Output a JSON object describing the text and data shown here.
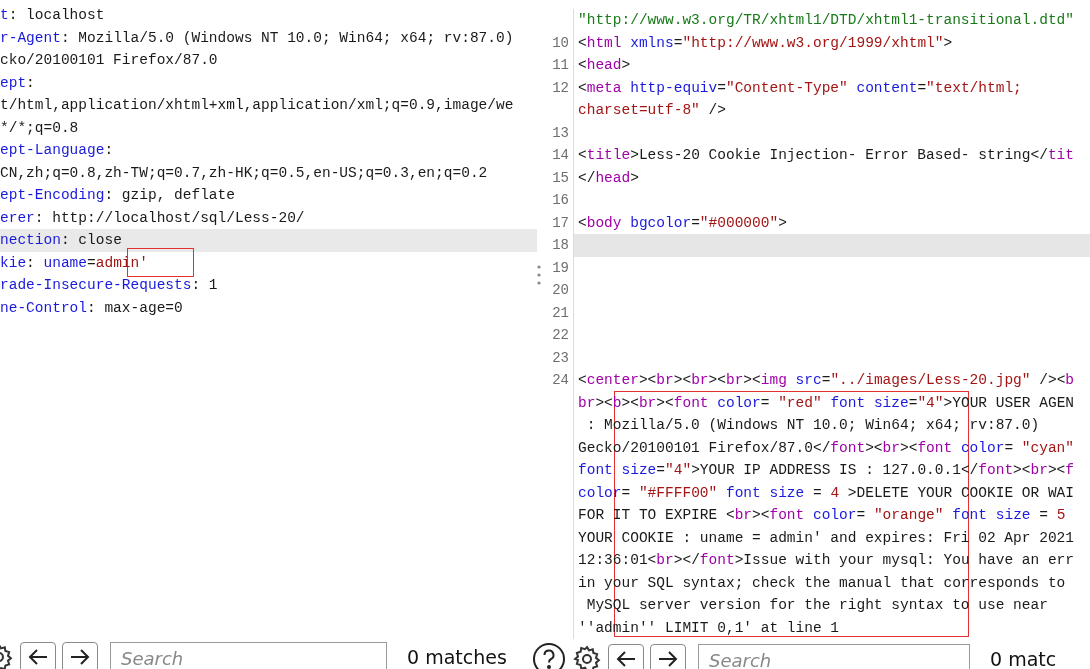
{
  "request_pane": {
    "lines": [
      {
        "current": false,
        "tokens": [
          {
            "kind": "attr",
            "text": "t"
          },
          {
            "kind": "text",
            "text": ": localhost"
          }
        ]
      },
      {
        "current": false,
        "tokens": [
          {
            "kind": "attr",
            "text": "r-Agent"
          },
          {
            "kind": "text",
            "text": ": Mozilla/5.0 (Windows NT 10.0; Win64; x64; rv:87.0)"
          }
        ]
      },
      {
        "current": false,
        "tokens": [
          {
            "kind": "text",
            "text": "cko/20100101 Firefox/87.0"
          }
        ]
      },
      {
        "current": false,
        "tokens": [
          {
            "kind": "attr",
            "text": "ept"
          },
          {
            "kind": "text",
            "text": ":"
          }
        ]
      },
      {
        "current": false,
        "tokens": [
          {
            "kind": "text",
            "text": "t/html,application/xhtml+xml,application/xml;q=0.9,image/we"
          }
        ]
      },
      {
        "current": false,
        "tokens": [
          {
            "kind": "text",
            "text": "*/*;q=0.8"
          }
        ]
      },
      {
        "current": false,
        "tokens": [
          {
            "kind": "attr",
            "text": "ept-Language"
          },
          {
            "kind": "text",
            "text": ":"
          }
        ]
      },
      {
        "current": false,
        "tokens": [
          {
            "kind": "text",
            "text": "CN,zh;q=0.8,zh-TW;q=0.7,zh-HK;q=0.5,en-US;q=0.3,en;q=0.2"
          }
        ]
      },
      {
        "current": false,
        "tokens": [
          {
            "kind": "attr",
            "text": "ept-Encoding"
          },
          {
            "kind": "text",
            "text": ": gzip, deflate"
          }
        ]
      },
      {
        "current": false,
        "tokens": [
          {
            "kind": "attr",
            "text": "erer"
          },
          {
            "kind": "text",
            "text": ": http://localhost/sql/Less-20/"
          }
        ]
      },
      {
        "current": true,
        "tokens": [
          {
            "kind": "attr",
            "text": "nection"
          },
          {
            "kind": "text",
            "text": ": close"
          }
        ]
      },
      {
        "current": false,
        "tokens": [
          {
            "kind": "attr",
            "text": "kie"
          },
          {
            "kind": "text",
            "text": ": "
          },
          {
            "kind": "attr",
            "text": "uname"
          },
          {
            "kind": "text",
            "text": "="
          },
          {
            "kind": "string",
            "text": "admin'"
          }
        ]
      },
      {
        "current": false,
        "tokens": [
          {
            "kind": "attr",
            "text": "rade-Insecure-Requests"
          },
          {
            "kind": "text",
            "text": ": 1"
          }
        ]
      },
      {
        "current": false,
        "tokens": [
          {
            "kind": "attr",
            "text": "ne-Control"
          },
          {
            "kind": "text",
            "text": ": max-age=0"
          }
        ]
      }
    ]
  },
  "response_pane": {
    "lines": [
      {
        "current": false,
        "rows": [
          {
            "tokens": [
              {
                "kind": "doctype",
                "text": "\"http://www.w3.org/TR/xhtml1/DTD/xhtml1-transitional.dtd\""
              }
            ]
          }
        ]
      },
      {
        "number": "10",
        "current": false,
        "rows": [
          {
            "tokens": [
              {
                "kind": "text",
                "text": "<"
              },
              {
                "kind": "tag",
                "text": "html "
              },
              {
                "kind": "attr",
                "text": "xmlns"
              },
              {
                "kind": "text",
                "text": "="
              },
              {
                "kind": "string",
                "text": "\"http://www.w3.org/1999/xhtml\""
              },
              {
                "kind": "text",
                "text": ">"
              }
            ]
          }
        ]
      },
      {
        "number": "11",
        "current": false,
        "rows": [
          {
            "tokens": [
              {
                "kind": "text",
                "text": "<"
              },
              {
                "kind": "tag",
                "text": "head"
              },
              {
                "kind": "text",
                "text": ">"
              }
            ]
          }
        ]
      },
      {
        "number": "12",
        "current": false,
        "rows": [
          {
            "tokens": [
              {
                "kind": "text",
                "text": "<"
              },
              {
                "kind": "tag",
                "text": "meta "
              },
              {
                "kind": "attr",
                "text": "http-equiv"
              },
              {
                "kind": "text",
                "text": "="
              },
              {
                "kind": "string",
                "text": "\"Content-Type\" "
              },
              {
                "kind": "attr",
                "text": "content"
              },
              {
                "kind": "text",
                "text": "="
              },
              {
                "kind": "string",
                "text": "\"text/html;"
              }
            ]
          },
          {
            "tokens": [
              {
                "kind": "string",
                "text": "charset=utf-8\""
              },
              {
                "kind": "text",
                "text": " />"
              }
            ]
          }
        ]
      },
      {
        "number": "13",
        "current": false,
        "rows": [
          {}
        ]
      },
      {
        "number": "14",
        "current": false,
        "rows": [
          {
            "tokens": [
              {
                "kind": "text",
                "text": "<"
              },
              {
                "kind": "tag",
                "text": "title"
              },
              {
                "kind": "text",
                "text": ">Less-20 Cookie Injection- Error Based- string</"
              },
              {
                "kind": "tag",
                "text": "tit"
              }
            ]
          }
        ]
      },
      {
        "number": "15",
        "current": false,
        "rows": [
          {
            "tokens": [
              {
                "kind": "text",
                "text": "</"
              },
              {
                "kind": "tag",
                "text": "head"
              },
              {
                "kind": "text",
                "text": ">"
              }
            ]
          }
        ]
      },
      {
        "number": "16",
        "current": false,
        "rows": [
          {}
        ]
      },
      {
        "number": "17",
        "current": false,
        "rows": [
          {
            "tokens": [
              {
                "kind": "text",
                "text": "<"
              },
              {
                "kind": "tag",
                "text": "body "
              },
              {
                "kind": "attr",
                "text": "bgcolor"
              },
              {
                "kind": "text",
                "text": "="
              },
              {
                "kind": "string",
                "text": "\"#000000\""
              },
              {
                "kind": "text",
                "text": ">"
              }
            ]
          }
        ]
      },
      {
        "number": "18",
        "current": true,
        "rows": [
          {}
        ]
      },
      {
        "number": "19",
        "current": false,
        "rows": [
          {}
        ]
      },
      {
        "number": "20",
        "current": false,
        "rows": [
          {}
        ]
      },
      {
        "number": "21",
        "current": false,
        "rows": [
          {}
        ]
      },
      {
        "number": "22",
        "current": false,
        "rows": [
          {}
        ]
      },
      {
        "number": "23",
        "current": false,
        "rows": [
          {}
        ]
      },
      {
        "number": "24",
        "current": false,
        "rows": [
          {
            "tokens": [
              {
                "kind": "text",
                "text": "<"
              },
              {
                "kind": "tag",
                "text": "center"
              },
              {
                "kind": "text",
                "text": "><"
              },
              {
                "kind": "tag",
                "text": "br"
              },
              {
                "kind": "text",
                "text": "><"
              },
              {
                "kind": "tag",
                "text": "br"
              },
              {
                "kind": "text",
                "text": "><"
              },
              {
                "kind": "tag",
                "text": "br"
              },
              {
                "kind": "text",
                "text": "><"
              },
              {
                "kind": "tag",
                "text": "img "
              },
              {
                "kind": "attr",
                "text": "src"
              },
              {
                "kind": "text",
                "text": "="
              },
              {
                "kind": "string",
                "text": "\"../images/Less-20.jpg\""
              },
              {
                "kind": "text",
                "text": " /><"
              },
              {
                "kind": "tag",
                "text": "b"
              }
            ]
          },
          {
            "tokens": [
              {
                "kind": "tag",
                "text": "br"
              },
              {
                "kind": "text",
                "text": "><"
              },
              {
                "kind": "tag",
                "text": "b"
              },
              {
                "kind": "text",
                "text": "><"
              },
              {
                "kind": "tag",
                "text": "br"
              },
              {
                "kind": "text",
                "text": "><"
              },
              {
                "kind": "tag",
                "text": "font "
              },
              {
                "kind": "attr",
                "text": "color"
              },
              {
                "kind": "text",
                "text": "= "
              },
              {
                "kind": "string",
                "text": "\"red\" "
              },
              {
                "kind": "attr",
                "text": "font size"
              },
              {
                "kind": "text",
                "text": "="
              },
              {
                "kind": "string",
                "text": "\"4\""
              },
              {
                "kind": "text",
                "text": ">YOUR USER AGEN"
              }
            ]
          },
          {
            "tokens": [
              {
                "kind": "text",
                "text": " : Mozilla/5.0 (Windows NT 10.0; Win64; x64; rv:87.0)"
              }
            ]
          },
          {
            "tokens": [
              {
                "kind": "text",
                "text": "Gecko/20100101 Firefox/87.0</"
              },
              {
                "kind": "tag",
                "text": "font"
              },
              {
                "kind": "text",
                "text": "><"
              },
              {
                "kind": "tag",
                "text": "br"
              },
              {
                "kind": "text",
                "text": "><"
              },
              {
                "kind": "tag",
                "text": "font "
              },
              {
                "kind": "attr",
                "text": "color"
              },
              {
                "kind": "text",
                "text": "= "
              },
              {
                "kind": "string",
                "text": "\"cyan\""
              }
            ]
          },
          {
            "tokens": [
              {
                "kind": "attr",
                "text": "font size"
              },
              {
                "kind": "text",
                "text": "="
              },
              {
                "kind": "string",
                "text": "\"4\""
              },
              {
                "kind": "text",
                "text": ">YOUR IP ADDRESS IS : 127.0.0.1</"
              },
              {
                "kind": "tag",
                "text": "font"
              },
              {
                "kind": "text",
                "text": "><"
              },
              {
                "kind": "tag",
                "text": "br"
              },
              {
                "kind": "text",
                "text": "><"
              },
              {
                "kind": "tag",
                "text": "f"
              }
            ]
          },
          {
            "tokens": [
              {
                "kind": "attr",
                "text": "color"
              },
              {
                "kind": "text",
                "text": "= "
              },
              {
                "kind": "string",
                "text": "\"#FFFF00\" "
              },
              {
                "kind": "attr",
                "text": "font size"
              },
              {
                "kind": "text",
                "text": " = "
              },
              {
                "kind": "string",
                "text": "4"
              },
              {
                "kind": "text",
                "text": " >DELETE YOUR COOKIE OR WAI"
              }
            ]
          },
          {
            "tokens": [
              {
                "kind": "text",
                "text": "FOR IT TO EXPIRE <"
              },
              {
                "kind": "tag",
                "text": "br"
              },
              {
                "kind": "text",
                "text": "><"
              },
              {
                "kind": "tag",
                "text": "font "
              },
              {
                "kind": "attr",
                "text": "color"
              },
              {
                "kind": "text",
                "text": "= "
              },
              {
                "kind": "string",
                "text": "\"orange\" "
              },
              {
                "kind": "attr",
                "text": "font size"
              },
              {
                "kind": "text",
                "text": " = "
              },
              {
                "kind": "string",
                "text": "5"
              }
            ]
          },
          {
            "tokens": [
              {
                "kind": "text",
                "text": "YOUR COOKIE : uname = admin' and expires: Fri 02 Apr 2021"
              }
            ]
          },
          {
            "tokens": [
              {
                "kind": "text",
                "text": "12:36:01<"
              },
              {
                "kind": "tag",
                "text": "br"
              },
              {
                "kind": "text",
                "text": "></"
              },
              {
                "kind": "tag",
                "text": "font"
              },
              {
                "kind": "text",
                "text": ">Issue with your mysql: You have an err"
              }
            ]
          },
          {
            "tokens": [
              {
                "kind": "text",
                "text": "in your SQL syntax; check the manual that corresponds to"
              }
            ]
          },
          {
            "tokens": [
              {
                "kind": "text",
                "text": " MySQL server version for the right syntax to use near"
              }
            ]
          },
          {
            "tokens": [
              {
                "kind": "text",
                "text": "''admin'' LIMIT 0,1' at line 1"
              }
            ]
          }
        ]
      }
    ]
  },
  "left_search": {
    "placeholder": "Search",
    "matches": "0 matches"
  },
  "right_search": {
    "placeholder": "Search",
    "matches": "0 matc"
  }
}
